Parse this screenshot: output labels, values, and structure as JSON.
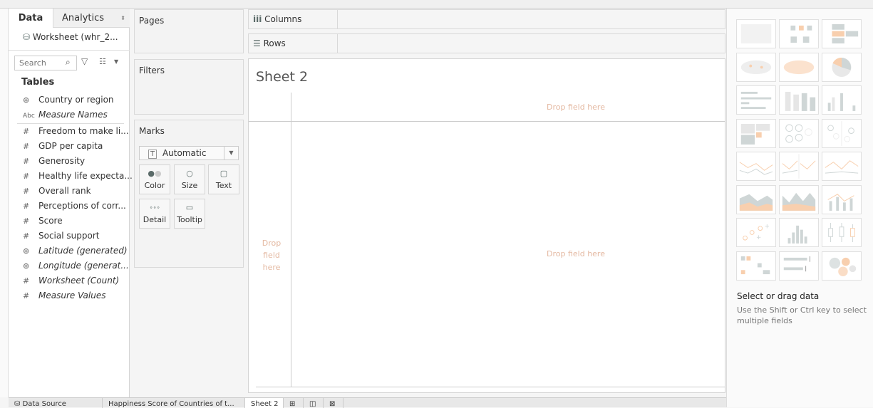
{
  "data_pane": {
    "tabs": [
      "Data",
      "Analytics"
    ],
    "datasource": "Worksheet (whr_2...",
    "search_placeholder": "Search",
    "tables_heading": "Tables",
    "dimensions": [
      {
        "icon": "globe-icon",
        "glyph": "⊕",
        "label": "Country or region",
        "italic": false
      },
      {
        "icon": "abc-icon",
        "glyph": "Abc",
        "label": "Measure Names",
        "italic": true
      }
    ],
    "measures": [
      {
        "icon": "hash-icon",
        "glyph": "#",
        "label": "Freedom to make li...",
        "italic": false
      },
      {
        "icon": "hash-icon",
        "glyph": "#",
        "label": "GDP per capita",
        "italic": false
      },
      {
        "icon": "hash-icon",
        "glyph": "#",
        "label": "Generosity",
        "italic": false
      },
      {
        "icon": "hash-icon",
        "glyph": "#",
        "label": "Healthy life expecta...",
        "italic": false
      },
      {
        "icon": "hash-icon",
        "glyph": "#",
        "label": "Overall rank",
        "italic": false
      },
      {
        "icon": "hash-icon",
        "glyph": "#",
        "label": "Perceptions of corr...",
        "italic": false
      },
      {
        "icon": "hash-icon",
        "glyph": "#",
        "label": "Score",
        "italic": false
      },
      {
        "icon": "hash-icon",
        "glyph": "#",
        "label": "Social support",
        "italic": false
      },
      {
        "icon": "globe-icon",
        "glyph": "⊕",
        "label": "Latitude (generated)",
        "italic": true
      },
      {
        "icon": "globe-icon",
        "glyph": "⊕",
        "label": "Longitude (generat...",
        "italic": true
      },
      {
        "icon": "hash-icon",
        "glyph": "#",
        "label": "Worksheet (Count)",
        "italic": true
      },
      {
        "icon": "hash-icon",
        "glyph": "#",
        "label": "Measure Values",
        "italic": true
      }
    ]
  },
  "cards": {
    "pages": "Pages",
    "filters": "Filters",
    "marks": "Marks"
  },
  "marks": {
    "type": "Automatic",
    "buttons": [
      "Color",
      "Size",
      "Text",
      "Detail",
      "Tooltip"
    ]
  },
  "shelves": {
    "columns": "Columns",
    "rows": "Rows"
  },
  "sheet": {
    "title": "Sheet 2",
    "drop_top": "Drop field here",
    "drop_center": "Drop field here",
    "drop_left": [
      "Drop",
      "field",
      "here"
    ]
  },
  "show_me": {
    "heading": "Select or drag data",
    "hint": "Use the Shift or Ctrl key to select multiple fields",
    "accent": "#f8cfae",
    "neutral": "#cfd6d6"
  },
  "bottom_tabs": [
    "Data Source",
    "Happiness Score of Countries of t...",
    "Sheet 2"
  ]
}
